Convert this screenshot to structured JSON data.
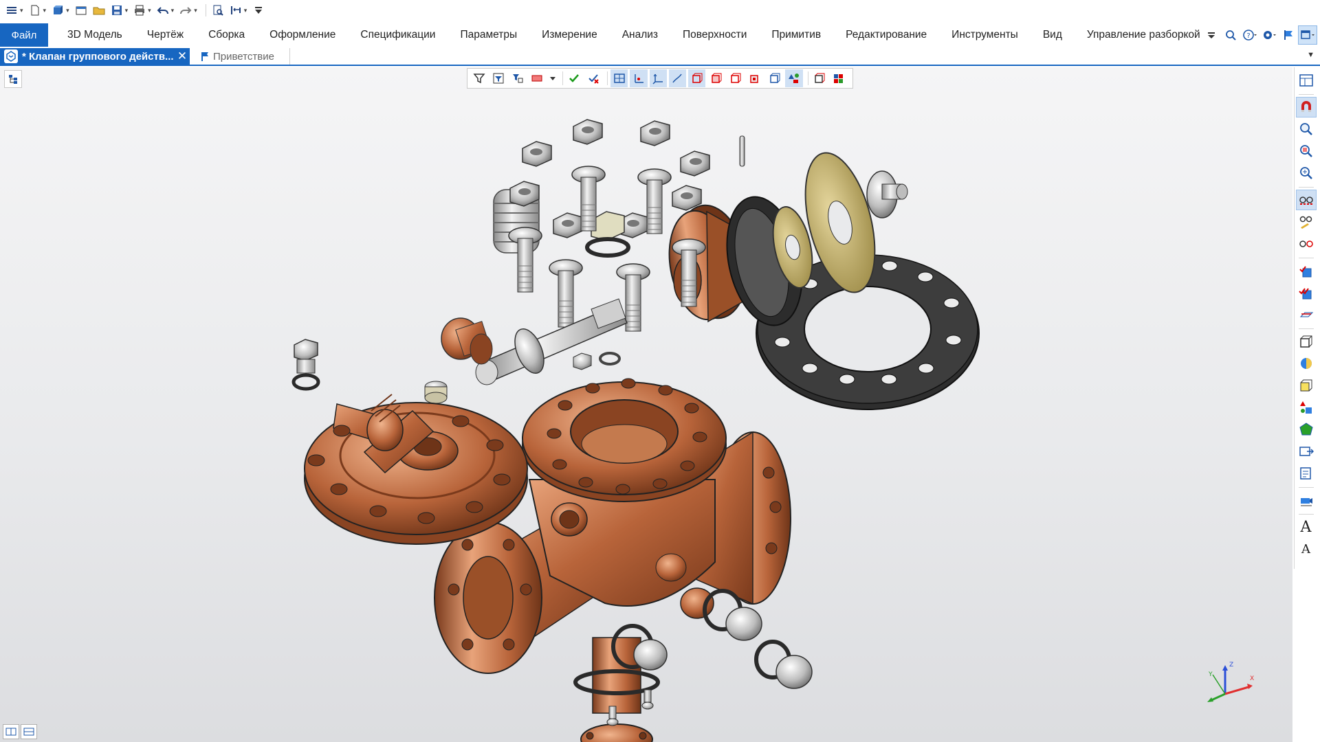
{
  "quick_access": {
    "icons": [
      "menu-icon",
      "new-document-icon",
      "new-part-icon",
      "open-dialog-icon",
      "open-folder-icon",
      "save-icon",
      "print-icon",
      "undo-icon",
      "redo-icon",
      "find-icon",
      "macro-icon",
      "customize-icon"
    ]
  },
  "ribbon": {
    "file_label": "Файл",
    "tabs": [
      "3D Модель",
      "Чертёж",
      "Сборка",
      "Оформление",
      "Спецификации",
      "Параметры",
      "Измерение",
      "Анализ",
      "Поверхности",
      "Примитив",
      "Редактирование",
      "Инструменты",
      "Вид",
      "Управление разборкой"
    ]
  },
  "document_tabs": {
    "active_title": "* Клапан группового действ...",
    "active_close": "✕",
    "second_title": "Приветствие"
  },
  "view_toolbar": {
    "buttons": [
      "filter-icon",
      "filter-list-icon",
      "filter-select-icon",
      "color-fill-icon",
      "apply-check-icon",
      "clear-check-icon",
      "plane-icon",
      "axis-icon",
      "csys-icon",
      "curve-icon",
      "face-icon",
      "body-icon",
      "solid-icon",
      "shell-icon",
      "frame-icon",
      "assembly-icon",
      "component-icon",
      "color-component-icon"
    ]
  },
  "triad": {
    "x_label": "X",
    "y_label": "Y",
    "z_label": "Z",
    "x_color": "#e03030",
    "y_color": "#2aa02a",
    "z_color": "#2c4fd8"
  },
  "colors": {
    "accent": "#1766c1",
    "copper": "#b8643a",
    "steel": "#c8c8c8",
    "gasket": "#3a3a3a",
    "washer_gold": "#c8b676"
  }
}
